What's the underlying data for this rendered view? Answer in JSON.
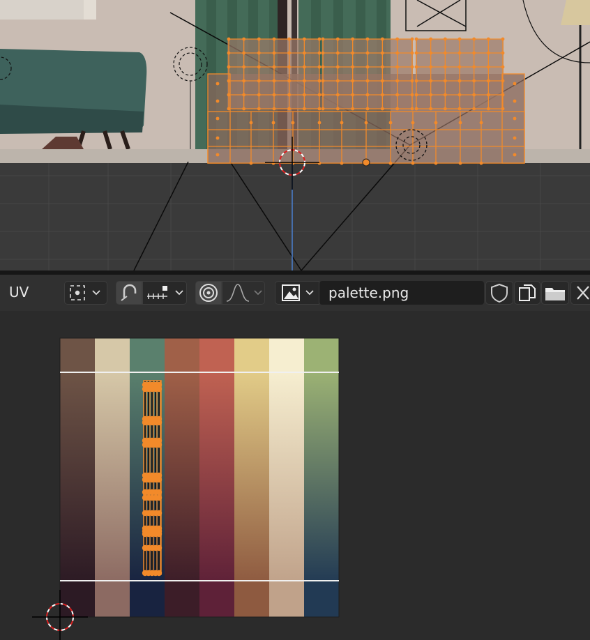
{
  "editor": {
    "uv_label": "UV",
    "image_name": "palette.png"
  },
  "icons": {
    "pivot": "pivot-point-icon",
    "snap": "snap-magnet-icon",
    "snap_increment": "snap-increment-icon",
    "proportional": "proportional-editing-icon",
    "falloff": "proportional-falloff-icon",
    "image_browse": "image-browse-icon",
    "fake_user": "fake-user-shield-icon",
    "new_image": "new-image-icon",
    "open_image": "open-folder-icon",
    "unlink": "close-icon"
  },
  "colors": {
    "selection": "#f28a2a",
    "viewport_bg": "#3b3b3b",
    "uv_bg": "#2b2b2b"
  },
  "palette": [
    {
      "top": "#6e5446",
      "bottom": "#2c1a24"
    },
    {
      "top": "#d6c8a8",
      "bottom": "#8c6a62"
    },
    {
      "top": "#5a806d",
      "bottom": "#182340"
    },
    {
      "top": "#a06048",
      "bottom": "#3c1d28"
    },
    {
      "top": "#c06252",
      "bottom": "#5e2138"
    },
    {
      "top": "#e2cc88",
      "bottom": "#8e5a40"
    },
    {
      "top": "#f6eed0",
      "bottom": "#c0a28a"
    },
    {
      "top": "#9cb274",
      "bottom": "#223a54"
    }
  ]
}
